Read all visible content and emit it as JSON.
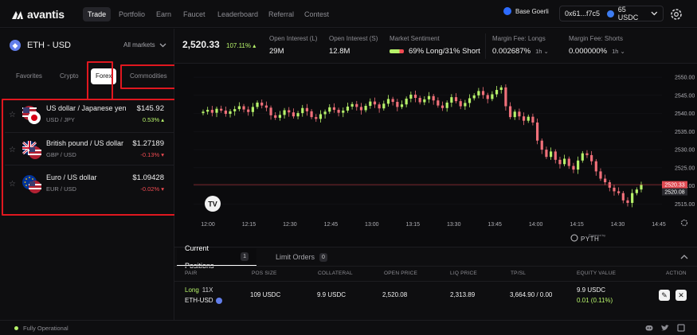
{
  "brand": {
    "name": "avantis"
  },
  "nav": {
    "items": [
      {
        "label": "Trade",
        "active": true
      },
      {
        "label": "Portfolio"
      },
      {
        "label": "Earn"
      },
      {
        "label": "Faucet"
      },
      {
        "label": "Leaderboard"
      },
      {
        "label": "Referral"
      },
      {
        "label": "Contest"
      }
    ],
    "network": "Base Goerli",
    "address": "0x61...f7c5",
    "balance": "65 USDC"
  },
  "market": {
    "pair": "ETH - USD",
    "all_markets": "All markets",
    "tabs": [
      "Favorites",
      "Crypto",
      "Forex",
      "Commodities"
    ],
    "active_tab": "Forex",
    "rows": [
      {
        "name": "US dollar / Japanese yen",
        "symbol": "USD / JPY",
        "price": "$145.92",
        "change": "0.53%",
        "dir": "up"
      },
      {
        "name": "British pound / US dollar",
        "symbol": "GBP / USD",
        "price": "$1.27189",
        "change": "-0.13%",
        "dir": "down"
      },
      {
        "name": "Euro / US dollar",
        "symbol": "EUR / USD",
        "price": "$1.09428",
        "change": "-0.02%",
        "dir": "down"
      }
    ]
  },
  "stats": {
    "price": "2,520.33",
    "change": "107.11%",
    "oi_long_label": "Open Interest (L)",
    "oi_long": "29M",
    "oi_short_label": "Open Interest (S)",
    "oi_short": "12.8M",
    "sentiment_label": "Market Sentiment",
    "sentiment": "69% Long/31% Short",
    "sentiment_long_pct": 69,
    "fee_long_label": "Margin Fee: Longs",
    "fee_long": "0.002687%",
    "fee_long_unit": "1h",
    "fee_short_label": "Margin Fee: Shorts",
    "fee_short": "0.000000%",
    "fee_short_unit": "1h"
  },
  "chart": {
    "y_ticks": [
      "2550.00",
      "2545.00",
      "2540.00",
      "2535.00",
      "2530.00",
      "2525.00",
      "2520.00",
      "2515.00"
    ],
    "x_ticks": [
      "12:00",
      "12:15",
      "12:30",
      "12:45",
      "13:00",
      "13:15",
      "13:30",
      "13:45",
      "14:00",
      "14:15",
      "14:30",
      "14:45"
    ],
    "last_price": "2520.33",
    "last_price2": "2520.08",
    "powered_by_small": "Powered by",
    "powered_by": "PYTH",
    "colors": {
      "up": "#b6f26a",
      "down": "#f0707a"
    }
  },
  "chart_data": {
    "type": "candlestick",
    "x_range": [
      "12:00",
      "14:45"
    ],
    "ylim": [
      2512,
      2552
    ],
    "closes": [
      2540.5,
      2541.0,
      2540.2,
      2541.3,
      2540.8,
      2539.9,
      2540.6,
      2541.2,
      2542.0,
      2541.1,
      2540.4,
      2541.8,
      2543.0,
      2542.2,
      2541.6,
      2539.5,
      2538.8,
      2539.6,
      2540.9,
      2540.3,
      2539.2,
      2540.1,
      2541.5,
      2540.6,
      2539.0,
      2538.5,
      2539.8,
      2540.5,
      2541.7,
      2541.0,
      2540.2,
      2540.8,
      2541.9,
      2542.6,
      2541.8,
      2540.9,
      2542.1,
      2543.3,
      2542.5,
      2541.4,
      2542.7,
      2544.0,
      2543.2,
      2541.8,
      2542.5,
      2544.1,
      2545.2,
      2544.3,
      2543.1,
      2543.9,
      2544.8,
      2543.6,
      2542.2,
      2541.5,
      2543.0,
      2544.5,
      2543.4,
      2542.0,
      2542.9,
      2544.2,
      2545.0,
      2546.2,
      2545.1,
      2544.0,
      2545.3,
      2546.5,
      2547.2,
      2542.0,
      2539.0,
      2540.5,
      2539.2,
      2538.0,
      2539.1,
      2537.5,
      2532.5,
      2530.0,
      2528.0,
      2529.5,
      2527.2,
      2526.0,
      2527.5,
      2525.5,
      2524.5,
      2527.0,
      2529.0,
      2528.5,
      2526.8,
      2524.0,
      2522.0,
      2521.0,
      2519.5,
      2518.5,
      2518.0,
      2516.0,
      2515.3,
      2518.0,
      2519.0,
      2520.3
    ]
  },
  "positions": {
    "tabs": [
      {
        "label": "Current Positions",
        "count": "1"
      },
      {
        "label": "Limit Orders",
        "count": "0"
      }
    ],
    "headers": [
      "PAIR",
      "POS SIZE",
      "COLLATERAL",
      "OPEN PRICE",
      "LIQ PRICE",
      "TP/SL",
      "EQUITY VALUE",
      "ACTION"
    ],
    "row": {
      "side": "Long",
      "leverage": "11X",
      "pair": "ETH-USD",
      "pos_size": "109 USDC",
      "collateral": "9.9 USDC",
      "open_price": "2,520.08",
      "liq_price": "2,313.89",
      "tpsl": "3,664.90 / 0.00",
      "equity": "9.9 USDC",
      "pnl": "0.01 (0.11%)"
    }
  },
  "footer": {
    "status": "Fully Operational"
  }
}
